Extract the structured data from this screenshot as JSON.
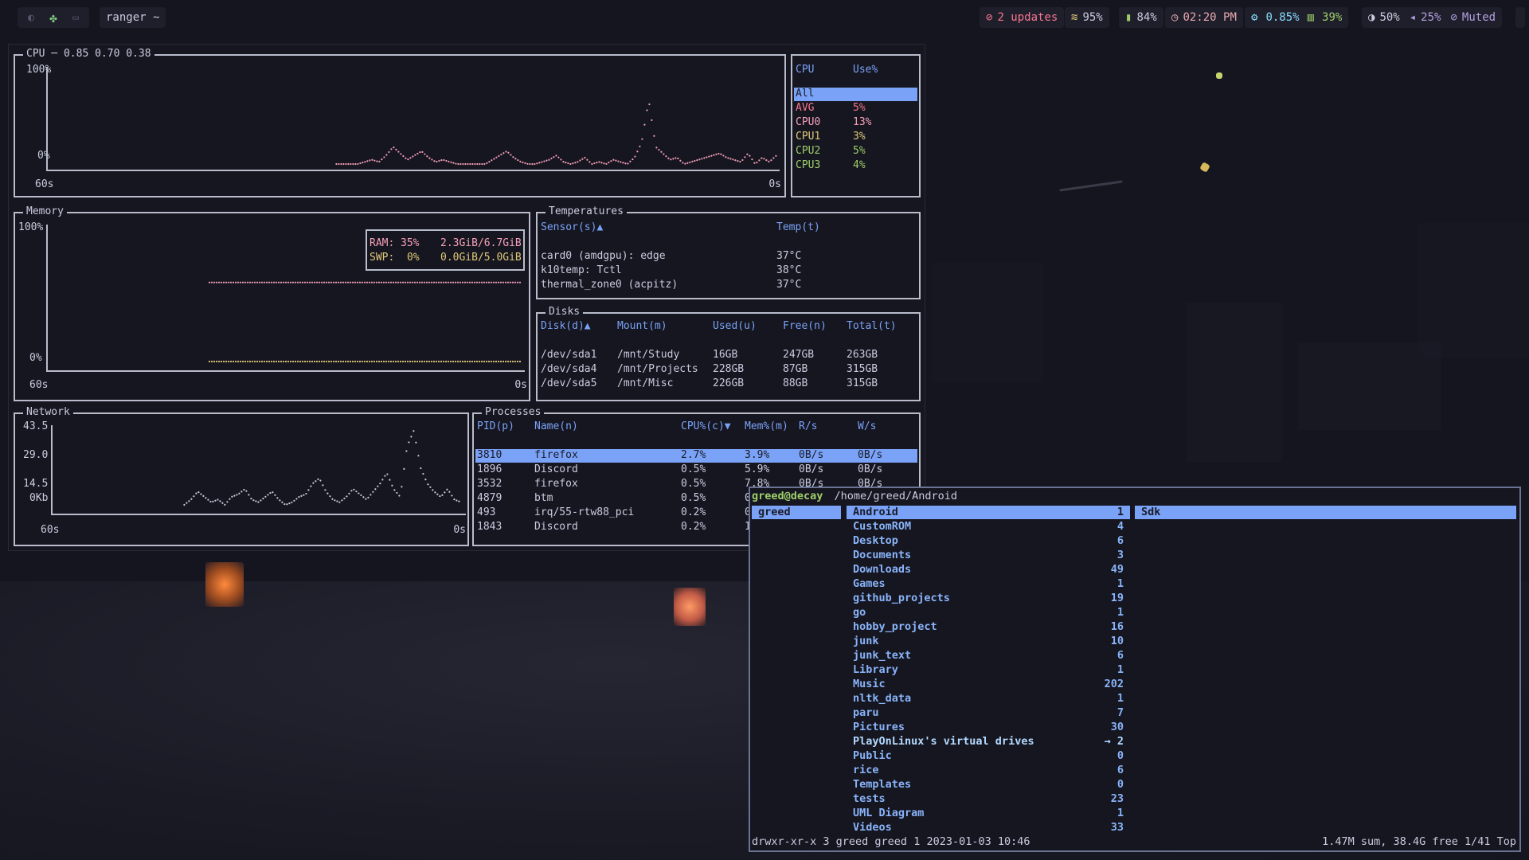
{
  "topbar": {
    "workspaces": [
      {
        "icon": "moon-icon",
        "glyph": "◐",
        "active": false
      },
      {
        "icon": "clover-icon",
        "glyph": "✤",
        "active": true
      },
      {
        "icon": "monitor-icon",
        "glyph": "▭",
        "active": false
      }
    ],
    "window_title": "ranger ~",
    "updates": "2 updates",
    "wifi": "95%",
    "battery": "84%",
    "clock": "02:20 PM",
    "cpu": "0.85%",
    "memory": "39%",
    "brightness": "50%",
    "volume": "25%",
    "mute": "Muted"
  },
  "btm": {
    "cpu": {
      "title": "CPU ─ 0.85 0.70 0.38",
      "y_max": "100%",
      "y_min": "0%",
      "x_left": "60s",
      "x_right": "0s",
      "table_headers": [
        "CPU",
        "Use%"
      ],
      "rows": [
        {
          "name": "All",
          "use": "",
          "selected": true
        },
        {
          "name": "AVG",
          "use": "5%",
          "color": "#f7768e"
        },
        {
          "name": "CPU0",
          "use": "13%",
          "color": "#f5a0b8"
        },
        {
          "name": "CPU1",
          "use": "3%",
          "color": "#e0c97a"
        },
        {
          "name": "CPU2",
          "use": "5%",
          "color": "#9ece6a"
        },
        {
          "name": "CPU3",
          "use": "4%",
          "color": "#9ece6a"
        }
      ],
      "chart_data": {
        "type": "line",
        "ylim": [
          0,
          100
        ],
        "xlim": [
          60,
          0
        ],
        "series": [
          {
            "values": [
              0,
              0,
              0,
              0,
              1,
              2,
              1,
              4,
              8,
              5,
              2,
              4,
              6,
              3,
              1,
              2,
              1,
              0,
              0,
              0,
              0,
              0,
              2,
              4,
              6,
              3,
              1,
              0,
              0,
              1,
              2,
              4,
              1,
              0,
              1,
              3,
              0,
              1,
              0,
              2,
              1,
              0,
              3,
              10,
              30,
              8,
              5,
              2,
              3,
              0,
              1,
              2,
              3,
              4,
              5,
              3,
              2,
              1,
              5,
              0,
              3,
              1,
              4
            ]
          }
        ]
      }
    },
    "memory": {
      "title": "Memory",
      "y_max": "100%",
      "y_min": "0%",
      "x_left": "60s",
      "x_right": "0s",
      "ram_label": "RAM:",
      "ram_pct": "35%",
      "ram_val": "2.3GiB/6.7GiB",
      "swp_label": "SWP:",
      "swp_pct": "0%",
      "swp_val": "0.0GiB/5.0GiB",
      "chart_data": {
        "type": "line",
        "ylim": [
          0,
          100
        ],
        "series": [
          {
            "name": "RAM",
            "value": 35
          },
          {
            "name": "SWP",
            "value": 0
          }
        ]
      }
    },
    "temps": {
      "title": "Temperatures",
      "headers": [
        "Sensor(s)▲",
        "Temp(t)"
      ],
      "rows": [
        [
          "card0 (amdgpu): edge",
          "37°C"
        ],
        [
          "k10temp: Tctl",
          "38°C"
        ],
        [
          "thermal_zone0 (acpitz)",
          "37°C"
        ]
      ]
    },
    "disks": {
      "title": "Disks",
      "headers": [
        "Disk(d)▲",
        "Mount(m)",
        "Used(u)",
        "Free(n)",
        "Total(t)"
      ],
      "rows": [
        [
          "/dev/sda1",
          "/mnt/Study",
          "16GB",
          "247GB",
          "263GB"
        ],
        [
          "/dev/sda4",
          "/mnt/Projects",
          "228GB",
          "87GB",
          "315GB"
        ],
        [
          "/dev/sda5",
          "/mnt/Misc",
          "226GB",
          "88GB",
          "315GB"
        ]
      ]
    },
    "network": {
      "title": "Network",
      "y_labels": [
        "43.5",
        "29.0",
        "14.5",
        "0Kb"
      ],
      "x_left": "60s",
      "x_right": "0s",
      "chart_data": {
        "type": "line",
        "ylim": [
          0,
          43.5
        ],
        "series": [
          {
            "values": [
              0,
              2,
              5,
              3,
              1,
              2,
              0,
              3,
              4,
              6,
              2,
              1,
              3,
              5,
              2,
              0,
              1,
              3,
              4,
              8,
              10,
              5,
              2,
              1,
              3,
              6,
              4,
              2,
              5,
              8,
              12,
              6,
              3,
              22,
              28,
              14,
              8,
              5,
              3,
              6,
              2,
              1
            ]
          }
        ]
      }
    },
    "processes": {
      "title": "Processes",
      "headers": [
        "PID(p)",
        "Name(n)",
        "CPU%(c)▼",
        "Mem%(m)",
        "R/s",
        "W/s"
      ],
      "rows": [
        [
          "3810",
          "firefox",
          "2.7%",
          "3.9%",
          "0B/s",
          "0B/s"
        ],
        [
          "1896",
          "Discord",
          "0.5%",
          "5.9%",
          "0B/s",
          "0B/s"
        ],
        [
          "3532",
          "firefox",
          "0.5%",
          "7.8%",
          "0B/s",
          "0B/s"
        ],
        [
          "4879",
          "btm",
          "0.5%",
          "0",
          "",
          ""
        ],
        [
          "493",
          "irq/55-rtw88_pci",
          "0.2%",
          "0",
          "",
          ""
        ],
        [
          "1843",
          "Discord",
          "0.2%",
          "1",
          "",
          ""
        ]
      ]
    }
  },
  "ranger": {
    "user_host": "greed@decay",
    "path": "/home/greed/Android",
    "parent": "greed",
    "preview": "Sdk",
    "entries": [
      {
        "name": "Android",
        "count": "1",
        "selected": true
      },
      {
        "name": "CustomROM",
        "count": "4"
      },
      {
        "name": "Desktop",
        "count": "6"
      },
      {
        "name": "Documents",
        "count": "3"
      },
      {
        "name": "Downloads",
        "count": "49"
      },
      {
        "name": "Games",
        "count": "1"
      },
      {
        "name": "github_projects",
        "count": "19"
      },
      {
        "name": "go",
        "count": "1"
      },
      {
        "name": "hobby_project",
        "count": "16"
      },
      {
        "name": "junk",
        "count": "10"
      },
      {
        "name": "junk_text",
        "count": "6"
      },
      {
        "name": "Library",
        "count": "1"
      },
      {
        "name": "Music",
        "count": "202"
      },
      {
        "name": "nltk_data",
        "count": "1"
      },
      {
        "name": "paru",
        "count": "7"
      },
      {
        "name": "Pictures",
        "count": "30"
      },
      {
        "name": "PlayOnLinux's virtual drives",
        "count": "→ 2",
        "link": true
      },
      {
        "name": "Public",
        "count": "0"
      },
      {
        "name": "rice",
        "count": "6"
      },
      {
        "name": "Templates",
        "count": "0"
      },
      {
        "name": "tests",
        "count": "23"
      },
      {
        "name": "UML Diagram",
        "count": "1"
      },
      {
        "name": "Videos",
        "count": "33"
      }
    ],
    "status_left": "drwxr-xr-x 3 greed greed 1 2023-01-03 10:46",
    "status_right": "1.47M sum, 38.4G free  1/41  Top"
  }
}
